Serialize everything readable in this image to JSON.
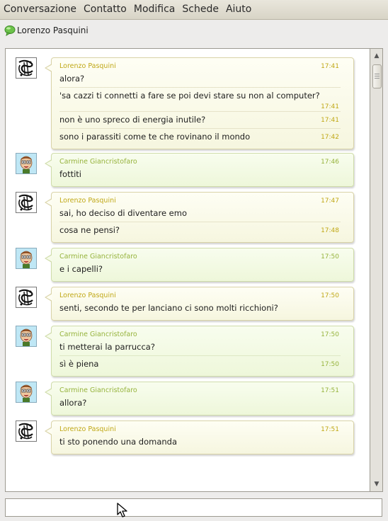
{
  "menu": [
    "Conversazione",
    "Contatto",
    "Modifica",
    "Schede",
    "Aiuto"
  ],
  "contact": {
    "name": "Lorenzo Pasquini"
  },
  "groups": [
    {
      "sender": "Lorenzo Pasquini",
      "who": "lorenzo",
      "time": "17:41",
      "messages": [
        {
          "text": "alora?",
          "time": ""
        },
        {
          "text": "'sa cazzi ti connetti a fare se poi devi stare su non al computer?",
          "time": "17:41"
        },
        {
          "text": "non è uno spreco di energia inutile?",
          "time": "17:41"
        },
        {
          "text": "sono i parassiti come te che rovinano il mondo",
          "time": "17:42"
        }
      ]
    },
    {
      "sender": "Carmine Giancristofaro",
      "who": "carmine",
      "time": "17:46",
      "messages": [
        {
          "text": "fottiti",
          "time": ""
        }
      ]
    },
    {
      "sender": "Lorenzo Pasquini",
      "who": "lorenzo",
      "time": "17:47",
      "messages": [
        {
          "text": "sai, ho deciso di diventare emo",
          "time": ""
        },
        {
          "text": "cosa ne pensi?",
          "time": "17:48"
        }
      ]
    },
    {
      "sender": "Carmine Giancristofaro",
      "who": "carmine",
      "time": "17:50",
      "messages": [
        {
          "text": "e i capelli?",
          "time": ""
        }
      ]
    },
    {
      "sender": "Lorenzo Pasquini",
      "who": "lorenzo",
      "time": "17:50",
      "messages": [
        {
          "text": "senti, secondo te per lanciano ci sono molti ricchioni?",
          "time": ""
        }
      ]
    },
    {
      "sender": "Carmine Giancristofaro",
      "who": "carmine",
      "time": "17:50",
      "messages": [
        {
          "text": "ti metterai la parrucca?",
          "time": ""
        },
        {
          "text": "sì è piena",
          "time": "17:50"
        }
      ]
    },
    {
      "sender": "Carmine Giancristofaro",
      "who": "carmine",
      "time": "17:51",
      "messages": [
        {
          "text": "allora?",
          "time": ""
        }
      ]
    },
    {
      "sender": "Lorenzo Pasquini",
      "who": "lorenzo",
      "time": "17:51",
      "messages": [
        {
          "text": "ti sto ponendo una domanda",
          "time": ""
        }
      ]
    }
  ],
  "input": {
    "value": ""
  },
  "colors": {
    "lorenzo_name": "#c0a816",
    "carmine_name": "#96b33c",
    "lorenzo_bubble": "#fbfbe8",
    "carmine_bubble": "#f2f9e2"
  },
  "icons": {
    "contact": "speech-bubble-icon",
    "lorenzo_avatar": "ornamental-letter-avatar",
    "carmine_avatar": "cartoon-face-avatar",
    "pointer": "mouse-pointer-icon"
  }
}
